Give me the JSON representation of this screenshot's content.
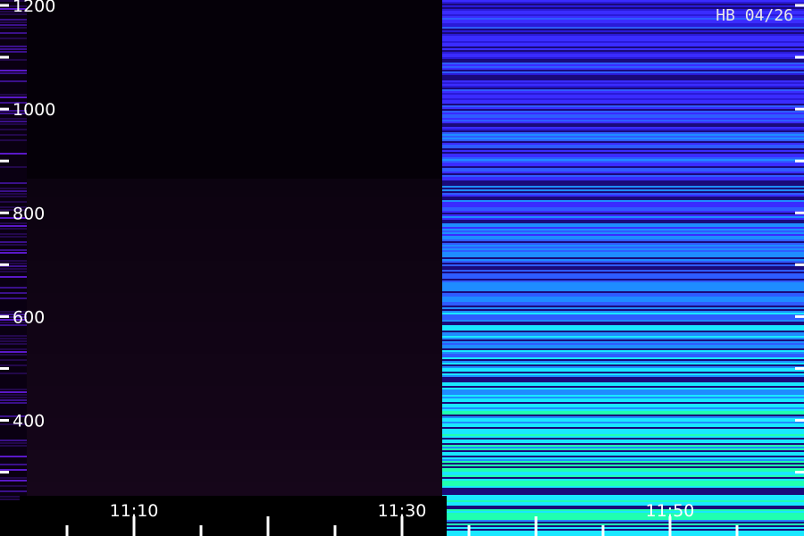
{
  "label": "HB 04/26",
  "chart_data": {
    "type": "heatmap",
    "title": "",
    "xlabel": "",
    "ylabel": "",
    "y_ticks": [
      400,
      600,
      800,
      1000,
      1200
    ],
    "x_ticks": [
      "11:10",
      "11:30",
      "11:50"
    ],
    "ylim": [
      270,
      1200
    ],
    "x_range": [
      "11:00",
      "11:60"
    ],
    "segments": [
      {
        "x_start": "11:00",
        "x_end": "11:02",
        "intensity": "low",
        "colormap": "purple"
      },
      {
        "x_start": "11:02",
        "x_end": "11:33",
        "intensity": "very-low",
        "colormap": "dark-purple"
      },
      {
        "x_start": "11:33",
        "x_end": "11:60",
        "intensity": "high",
        "colormap": "blue-cyan-green"
      }
    ],
    "colors": {
      "background": "#000000",
      "low": "#2a0a4a",
      "mid": "#3a2cff",
      "high": "#19e8ff",
      "peak": "#ffae00"
    }
  }
}
